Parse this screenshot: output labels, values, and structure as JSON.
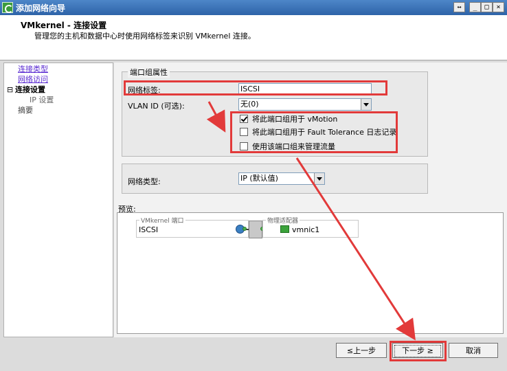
{
  "window": {
    "title": "添加网络向导",
    "buttons": [
      "↔",
      "_",
      "□",
      "×"
    ]
  },
  "header": {
    "title": "VMkernel - 连接设置",
    "subtitle": "管理您的主机和数据中心时使用网络标签来识别 VMkernel 连接。"
  },
  "nav": {
    "items": [
      {
        "label": "连接类型",
        "state": "link"
      },
      {
        "label": "网络访问",
        "state": "link"
      },
      {
        "label": "连接设置",
        "state": "current",
        "toggle": "⊟"
      },
      {
        "label": "IP 设置",
        "state": "sub"
      },
      {
        "label": "摘要",
        "state": "plain"
      }
    ]
  },
  "port_group": {
    "legend": "端口组属性",
    "network_label_label": "网络标签:",
    "network_label_value": "ISCSI",
    "vlan_label": "VLAN ID (可选):",
    "vlan_value": "无(0)",
    "checkboxes": [
      {
        "label": "将此端口组用于 vMotion",
        "checked": true
      },
      {
        "label": "将此端口组用于 Fault Tolerance 日志记录",
        "checked": false
      },
      {
        "label": "使用该端口组来管理流量",
        "checked": false
      }
    ]
  },
  "network_type": {
    "label": "网络类型:",
    "value": "IP (默认值)"
  },
  "preview": {
    "label": "预览:",
    "vmkernel_legend": "VMkernel 端口",
    "vmkernel_name": "ISCSI",
    "adapter_legend": "物理适配器",
    "adapter_name": "vmnic1"
  },
  "footer": {
    "back": "≤上一步",
    "next": "下一步 ≥",
    "cancel": "取消"
  },
  "colors": {
    "highlight": "#e23a3a",
    "link": "#5a2bd1"
  }
}
